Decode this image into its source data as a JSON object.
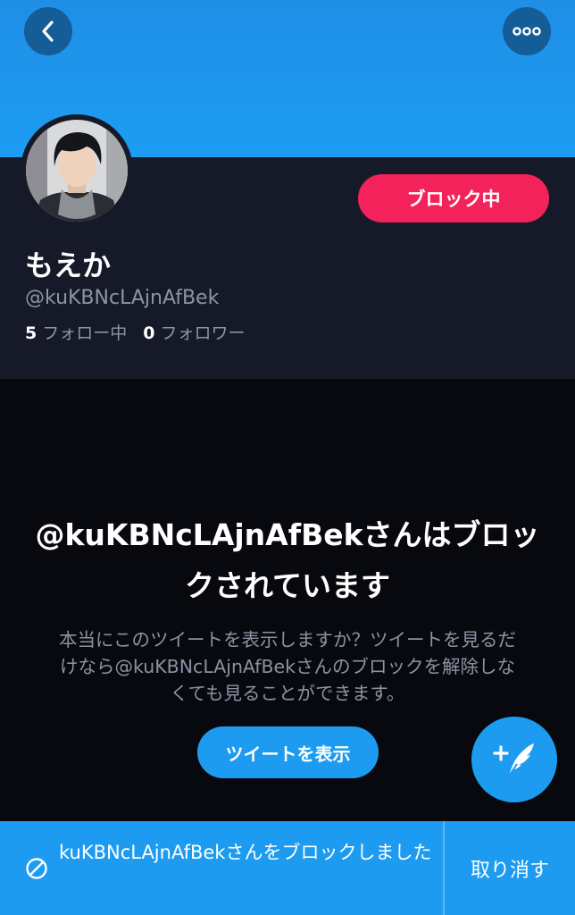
{
  "header": {
    "back_icon": "chevron-left-icon",
    "more_icon": "ellipsis-icon"
  },
  "profile": {
    "display_name": "もえか",
    "handle": "@kuKBNcLAjnAfBek",
    "block_button_label": "ブロック中",
    "following_count": "5",
    "following_label": "フォロー中",
    "followers_count": "0",
    "followers_label": "フォロワー"
  },
  "blocked_notice": {
    "title": "@kuKBNcLAjnAfBekさんはブロックされています",
    "description": "本当にこのツイートを表示しますか？ツイートを見るだけなら@kuKBNcLAjnAfBekさんのブロックを解除しなくても見ることができます。",
    "show_tweets_label": "ツイートを表示"
  },
  "compose": {
    "icon": "compose-feather-icon"
  },
  "snackbar": {
    "icon": "block-icon",
    "message": "kuKBNcLAjnAfBekさんをブロックしました",
    "undo_label": "取り消す"
  },
  "colors": {
    "banner": "#1c9df2",
    "panel": "#161a28",
    "background": "#08090e",
    "block_red": "#f4225a",
    "accent_blue": "#1d9bf0"
  }
}
